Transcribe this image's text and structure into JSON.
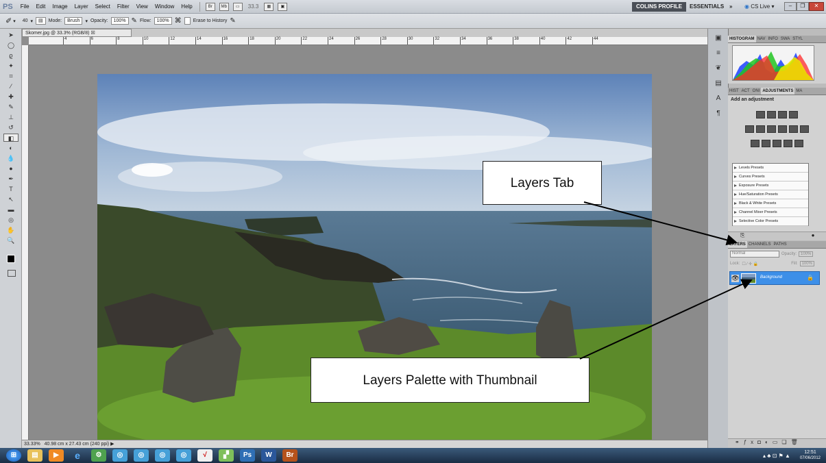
{
  "menubar": {
    "logo": "PS",
    "items": [
      "File",
      "Edit",
      "Image",
      "Layer",
      "Select",
      "Filter",
      "View",
      "Window",
      "Help"
    ],
    "zoom_value": "33.3",
    "workspace_active": "COLINS PROFILE",
    "workspace_essentials": "ESSENTIALS",
    "more": "»",
    "cslive": "CS Live"
  },
  "options": {
    "mode_label": "Mode:",
    "mode_value": "Brush",
    "opacity_label": "Opacity:",
    "opacity_value": "100%",
    "flow_label": "Flow:",
    "flow_value": "100%",
    "erase_history": "Erase to History",
    "brush_size": "40"
  },
  "document": {
    "tab_title": "Skomer.jpg @ 33.3% (RGB/8)",
    "zoom": "33.33%",
    "size_info": "40.98 cm x 27.43 cm (240 ppi)",
    "ruler_ticks": [
      "4",
      "6",
      "8",
      "10",
      "12",
      "14",
      "16",
      "18",
      "20",
      "22",
      "24",
      "26",
      "28",
      "30",
      "32",
      "34",
      "36",
      "38",
      "40",
      "42",
      "44"
    ]
  },
  "panels": {
    "top_tabs": [
      "HISTOGRAM",
      "NAV",
      "INFO",
      "SWA",
      "STYL"
    ],
    "adj_tabs": [
      "HIST",
      "ACT",
      "ONI",
      "ADJUSTMENTS",
      "MA"
    ],
    "adj_title": "Add an adjustment",
    "presets": [
      "Levels Presets",
      "Curves Presets",
      "Exposure Presets",
      "Hue/Saturation Presets",
      "Black & White Presets",
      "Channel Mixer Presets",
      "Selective Color Presets"
    ],
    "layer_tabs": [
      "LAYERS",
      "CHANNELS",
      "PATHS"
    ],
    "blend_mode": "Normal",
    "opacity_label": "Opacity:",
    "opacity_value": "100%",
    "lock_label": "Lock:",
    "fill_label": "Fill:",
    "fill_value": "100%",
    "layer_name": "Background"
  },
  "callouts": {
    "layers_tab": "Layers Tab",
    "layers_palette": "Layers Palette with Thumbnail"
  },
  "taskbar": {
    "time": "12:51",
    "date": "07/06/2012"
  }
}
